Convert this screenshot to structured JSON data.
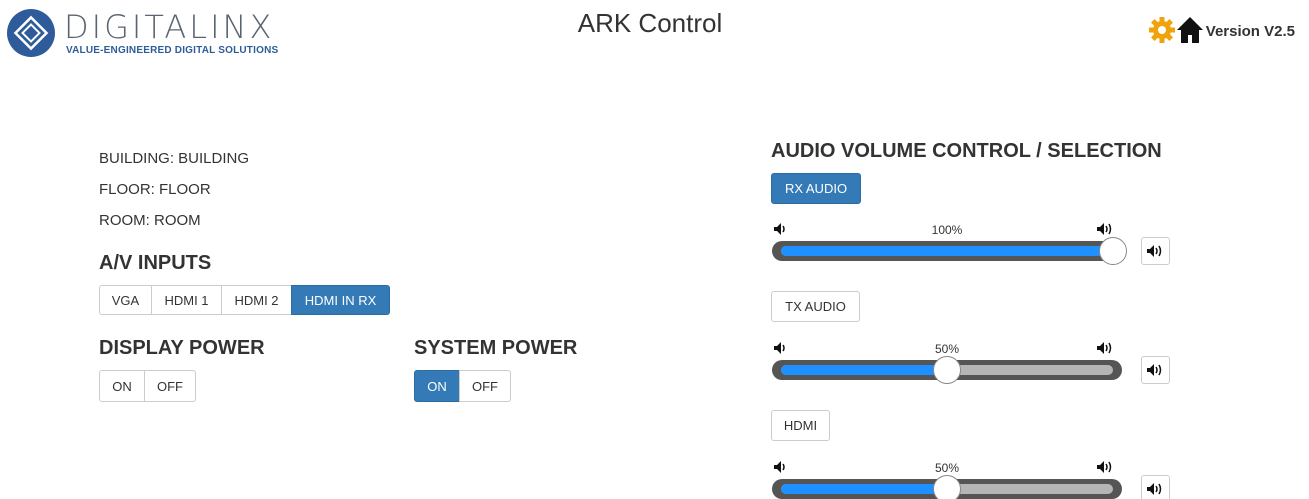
{
  "header": {
    "logo_name": "DIGITALINX",
    "logo_tagline": "VALUE-ENGINEERED DIGITAL SOLUTIONS",
    "title": "ARK Control",
    "settings_icon": "gear-icon",
    "home_icon": "home-icon",
    "version": "Version V2.5"
  },
  "location": {
    "building": "BUILDING: BUILDING",
    "floor": "FLOOR: FLOOR",
    "room": "ROOM: ROOM"
  },
  "av_inputs": {
    "title": "A/V INPUTS",
    "options": [
      "VGA",
      "HDMI 1",
      "HDMI 2",
      "HDMI IN RX"
    ],
    "selected": "HDMI IN RX"
  },
  "display_power": {
    "title": "DISPLAY POWER",
    "on_label": "ON",
    "off_label": "OFF",
    "selected": "none"
  },
  "system_power": {
    "title": "SYSTEM POWER",
    "on_label": "ON",
    "off_label": "OFF",
    "selected": "ON"
  },
  "audio": {
    "title": "AUDIO VOLUME CONTROL / SELECTION",
    "channels": [
      {
        "label": "RX AUDIO",
        "selected": true,
        "volume_text": "100%",
        "volume": 100
      },
      {
        "label": "TX AUDIO",
        "selected": false,
        "volume_text": "50%",
        "volume": 50
      },
      {
        "label": "HDMI",
        "selected": false,
        "volume_text": "50%",
        "volume": 50
      }
    ]
  },
  "colors": {
    "primary": "#337ab7",
    "slider_fill": "#1e90ff",
    "gear": "#f0a30a"
  }
}
